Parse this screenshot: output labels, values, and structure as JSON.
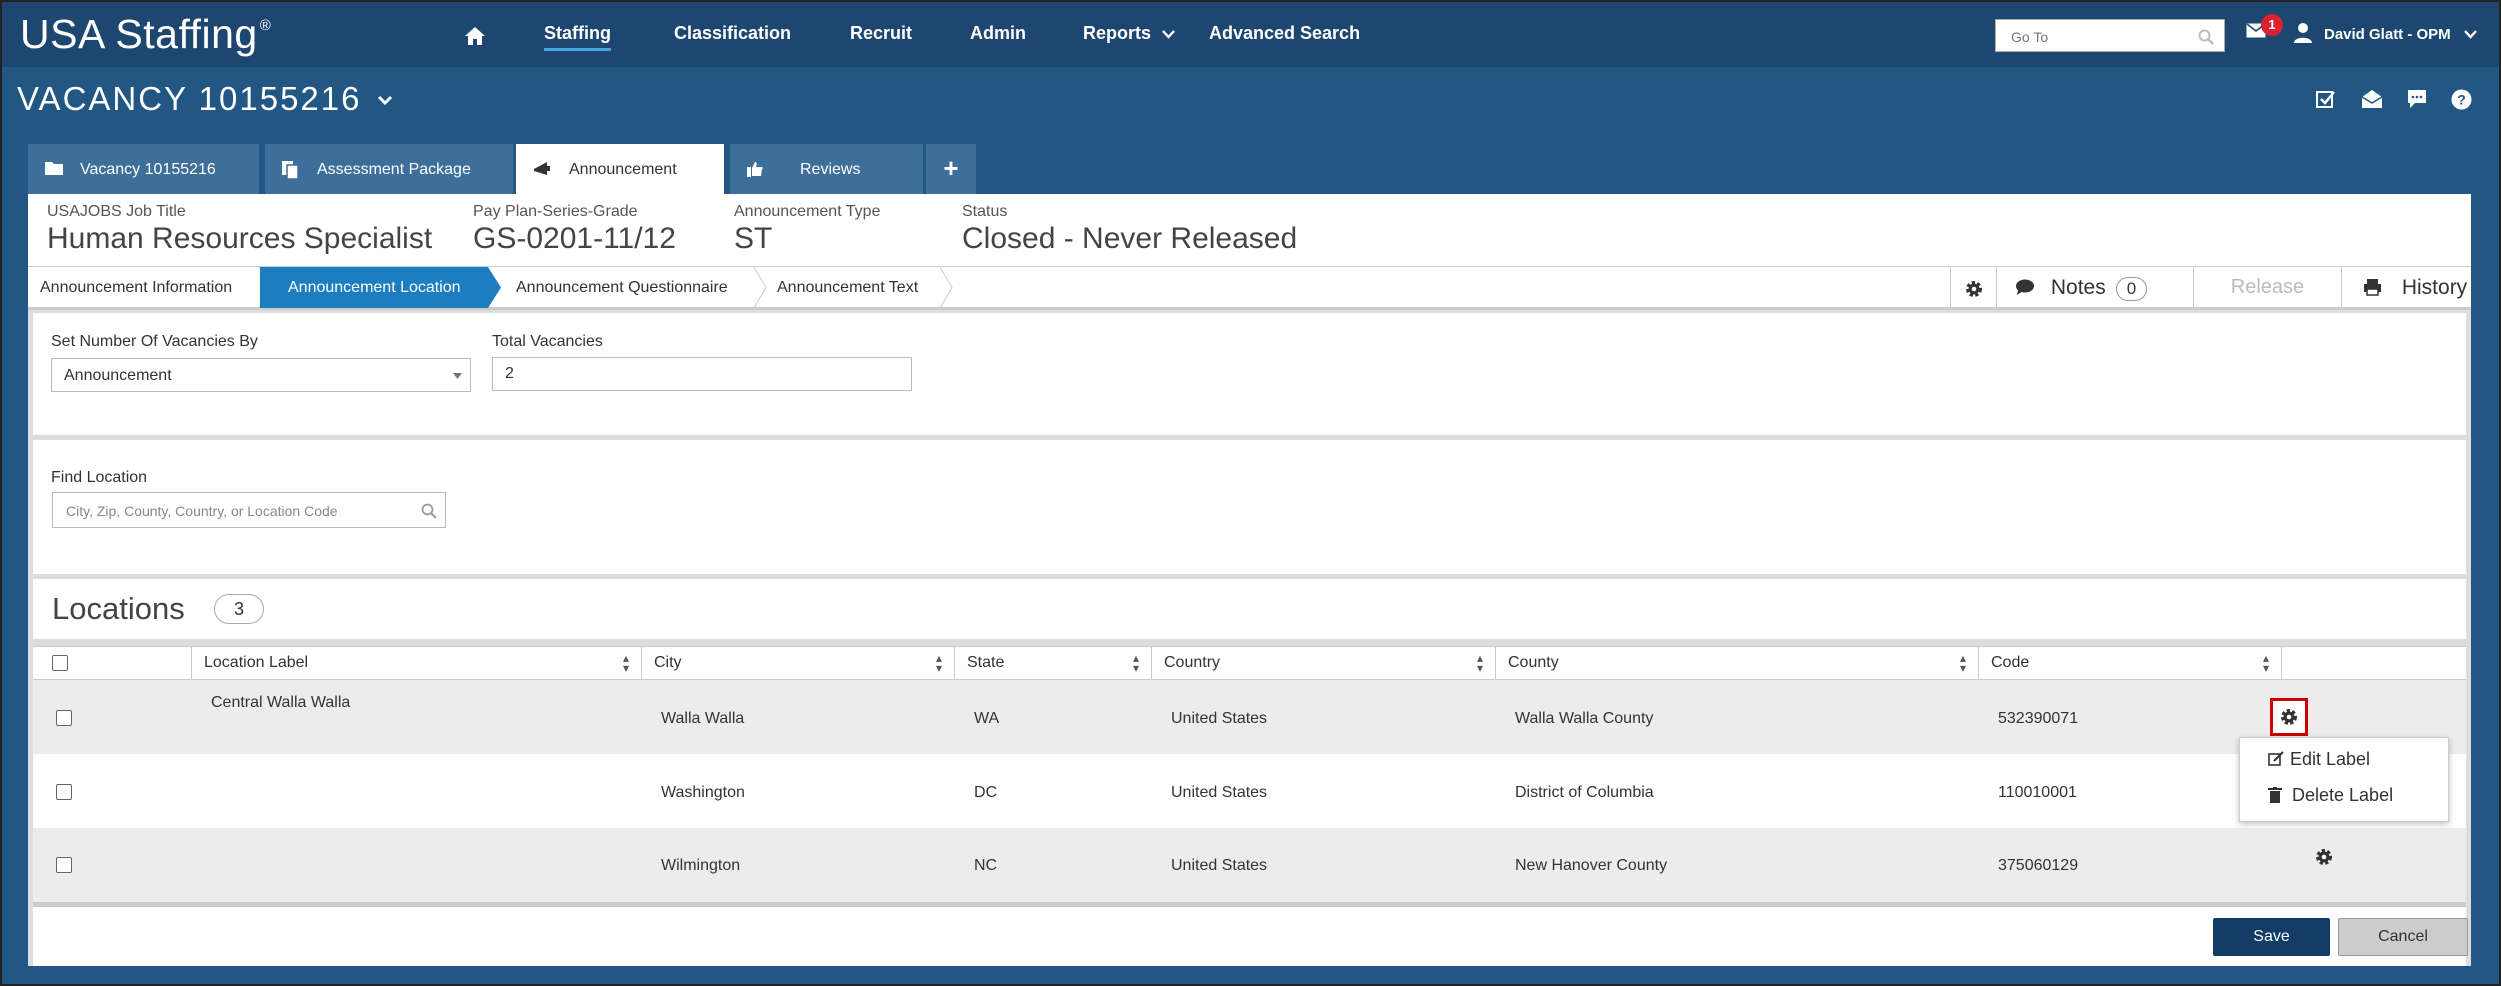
{
  "nav": {
    "logo": "USA Staffing",
    "logo_mark": "®",
    "items": [
      "Staffing",
      "Classification",
      "Recruit",
      "Admin",
      "Reports",
      "Advanced Search"
    ],
    "goto_placeholder": "Go To",
    "mail_badge": "1",
    "user": "David Glatt - OPM"
  },
  "vacancy": {
    "title": "VACANCY 10155216"
  },
  "tabs": [
    "Vacancy 10155216",
    "Assessment Package",
    "Announcement",
    "Reviews"
  ],
  "info": {
    "job_title_label": "USAJOBS Job Title",
    "job_title": "Human Resources Specialist",
    "grade_label": "Pay Plan-Series-Grade",
    "grade": "GS-0201-11/12",
    "type_label": "Announcement Type",
    "type": "ST",
    "status_label": "Status",
    "status": "Closed - Never Released"
  },
  "steps": [
    "Announcement Information",
    "Announcement Location",
    "Announcement Questionnaire",
    "Announcement Text"
  ],
  "tools": {
    "notes": "Notes",
    "notes_count": "0",
    "release": "Release",
    "history": "History"
  },
  "form": {
    "set_by_label": "Set Number Of Vacancies By",
    "set_by_value": "Announcement",
    "total_label": "Total Vacancies",
    "total_value": "2",
    "find_label": "Find Location",
    "find_placeholder": "City, Zip, County, Country, or Location Code"
  },
  "locations": {
    "title": "Locations",
    "count": "3",
    "columns": [
      "Location Label",
      "City",
      "State",
      "Country",
      "County",
      "Code"
    ],
    "rows": [
      {
        "label": "Central Walla Walla",
        "city": "Walla Walla",
        "state": "WA",
        "country": "United States",
        "county": "Walla Walla County",
        "code": "532390071"
      },
      {
        "label": "",
        "city": "Washington",
        "state": "DC",
        "country": "United States",
        "county": "District of Columbia",
        "code": "110010001"
      },
      {
        "label": "",
        "city": "Wilmington",
        "state": "NC",
        "country": "United States",
        "county": "New Hanover County",
        "code": "375060129"
      }
    ]
  },
  "context_menu": [
    "Edit Label",
    "Delete Label"
  ],
  "footer": {
    "save": "Save",
    "cancel": "Cancel"
  }
}
